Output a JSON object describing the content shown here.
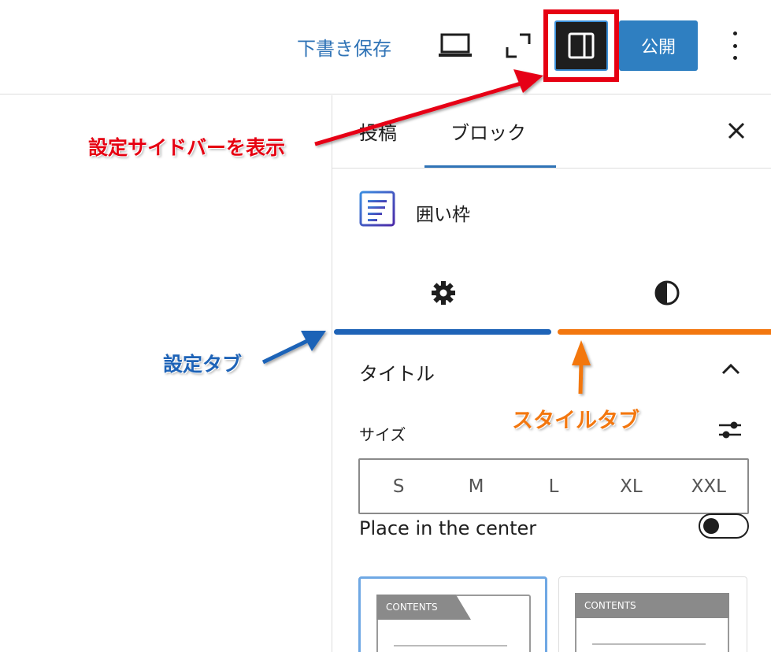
{
  "toolbar": {
    "save_draft_label": "下書き保存",
    "publish_label": "公開"
  },
  "sidebar": {
    "tabs": [
      {
        "label": "投稿"
      },
      {
        "label": "ブロック"
      }
    ],
    "block": {
      "name": "囲い枠"
    },
    "panel": {
      "title": "タイトル",
      "size_label": "サイズ",
      "size_options": [
        "S",
        "M",
        "L",
        "XL",
        "XXL"
      ],
      "center_label": "Place in the center",
      "center_toggle_on": false
    },
    "style_previews": [
      {
        "label": "CONTENTS"
      },
      {
        "label": "CONTENTS"
      }
    ]
  },
  "annotations": {
    "show_sidebar": "設定サイドバーを表示",
    "settings_tab": "設定タブ",
    "style_tab": "スタイルタブ"
  },
  "colors": {
    "accent": "#2f73b6",
    "publish": "#2f7fc1",
    "highlight_red": "#e60012",
    "settings_blue": "#1e63b7",
    "styles_orange": "#f3770f"
  }
}
